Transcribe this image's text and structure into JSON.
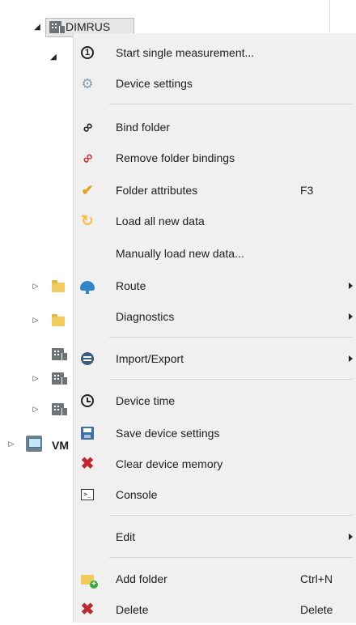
{
  "tree": {
    "root_label": "DIMRUS",
    "vm_label": "VM"
  },
  "menu": {
    "items": [
      {
        "label": "Start single measurement...",
        "shortcut": "",
        "submenu": false,
        "icon": "circle-one-icon"
      },
      {
        "label": "Device settings",
        "shortcut": "",
        "submenu": false,
        "icon": "gears-icon"
      },
      {
        "label": "Bind folder",
        "shortcut": "",
        "submenu": false,
        "icon": "link-icon"
      },
      {
        "label": "Remove folder bindings",
        "shortcut": "",
        "submenu": false,
        "icon": "unlink-icon"
      },
      {
        "label": "Folder attributes",
        "shortcut": "F3",
        "submenu": false,
        "icon": "checkmark-icon"
      },
      {
        "label": "Load all new data",
        "shortcut": "",
        "submenu": false,
        "icon": "refresh-icon"
      },
      {
        "label": "Manually load new data...",
        "shortcut": "",
        "submenu": false,
        "icon": ""
      },
      {
        "label": "Route",
        "shortcut": "",
        "submenu": true,
        "icon": "route-icon"
      },
      {
        "label": "Diagnostics",
        "shortcut": "",
        "submenu": true,
        "icon": ""
      },
      {
        "label": "Import/Export",
        "shortcut": "",
        "submenu": true,
        "icon": "import-export-icon"
      },
      {
        "label": "Device time",
        "shortcut": "",
        "submenu": false,
        "icon": "clock-icon"
      },
      {
        "label": "Save device settings",
        "shortcut": "",
        "submenu": false,
        "icon": "save-icon"
      },
      {
        "label": "Clear device memory",
        "shortcut": "",
        "submenu": false,
        "icon": "red-x-icon"
      },
      {
        "label": "Console",
        "shortcut": "",
        "submenu": false,
        "icon": "console-icon"
      },
      {
        "label": "Edit",
        "shortcut": "",
        "submenu": true,
        "icon": ""
      },
      {
        "label": "Add folder",
        "shortcut": "Ctrl+N",
        "submenu": false,
        "icon": "add-folder-icon"
      },
      {
        "label": "Delete",
        "shortcut": "Delete",
        "submenu": false,
        "icon": "red-x-icon"
      }
    ]
  },
  "colors": {
    "menu_bg": "#f0f0f0",
    "separator": "#d4d4d4",
    "selected_node_bg": "#e6e6e6",
    "delete_red": "#c0282d",
    "folder_yellow": "#f1cc5c"
  }
}
